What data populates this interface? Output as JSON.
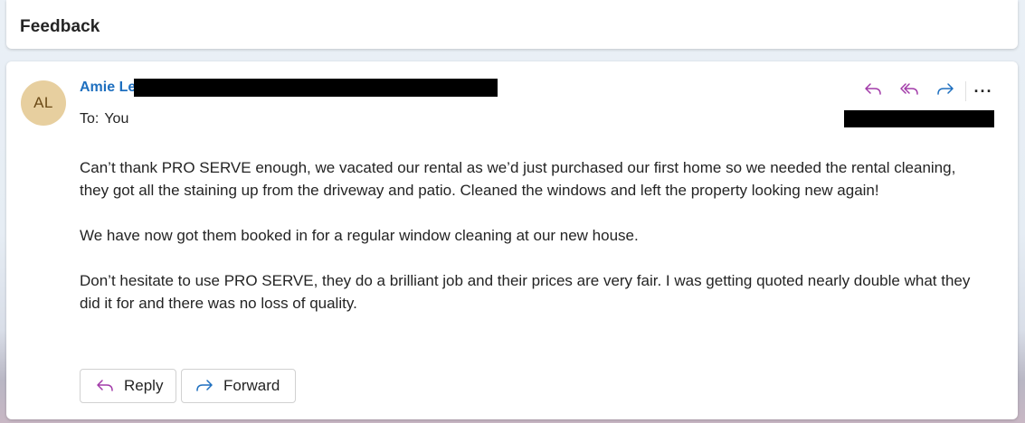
{
  "subject": {
    "title": "Feedback"
  },
  "message": {
    "avatar_initials": "AL",
    "sender_visible": "Amie Le",
    "to_label": "To:",
    "to_value": "You",
    "body": [
      "Can’t thank PRO SERVE enough, we vacated our rental as we’d just purchased our first home so we needed the rental cleaning, they got all the staining up from the driveway and patio. Cleaned the windows and left the property looking new again!",
      "We have now got them booked in for a regular window cleaning at our new house.",
      "Don’t hesitate to use PRO SERVE, they do a brilliant job and their prices are very fair. I was getting quoted nearly double what they did it for and there was no loss of quality."
    ]
  },
  "actions": {
    "icons": [
      "reply-icon",
      "reply-all-icon",
      "forward-icon",
      "more-icon"
    ],
    "more_glyph": "···"
  },
  "footer": {
    "reply_label": "Reply",
    "forward_label": "Forward"
  },
  "colors": {
    "sender": "#1e6fbf",
    "reply_icon": "#a23ba9",
    "forward_icon": "#1e6fbf",
    "avatar_bg": "#e7cf9f",
    "redaction": "#000000"
  }
}
